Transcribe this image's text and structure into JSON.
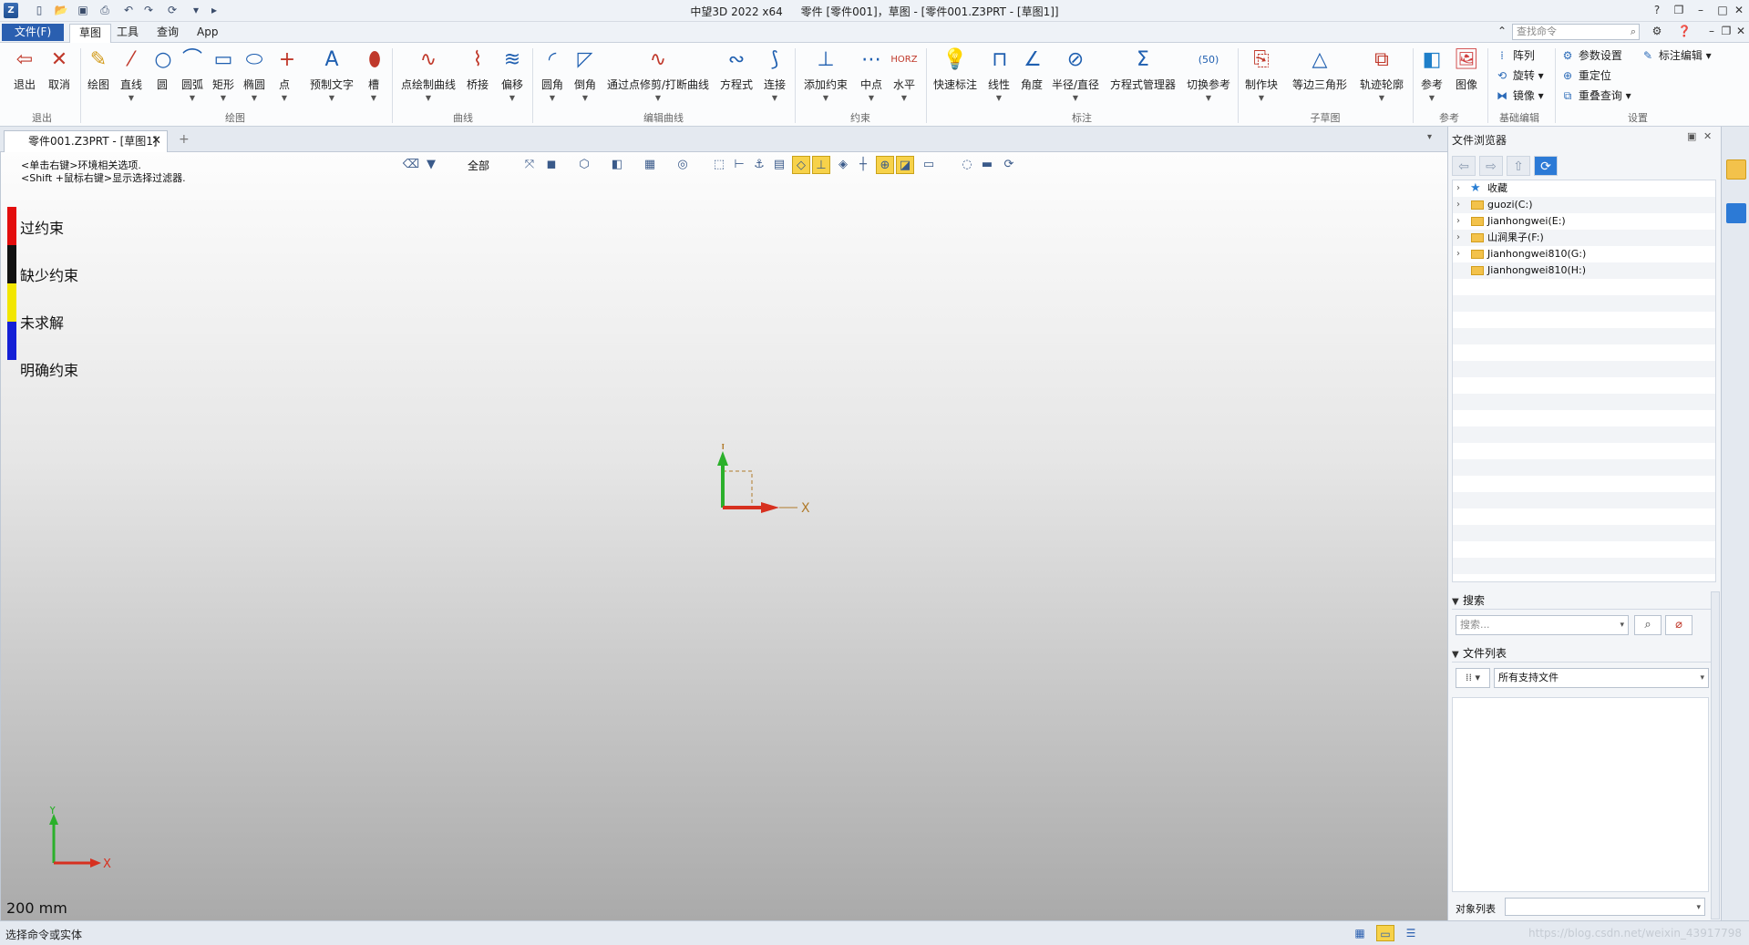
{
  "titlebar": {
    "app": "中望3D 2022 x64",
    "doc": "零件 [零件001]，草图 - [零件001.Z3PRT - [草图1]]"
  },
  "menu": {
    "file": "文件(F)",
    "tabs": [
      "草图",
      "工具",
      "查询",
      "App"
    ],
    "search_placeholder": "查找命令"
  },
  "ribbon": {
    "exit_group": {
      "label": "退出",
      "buttons": [
        "退出",
        "取消"
      ]
    },
    "draw_group": {
      "label": "绘图",
      "buttons": [
        "绘图",
        "直线",
        "圆",
        "圆弧",
        "矩形",
        "椭圆",
        "点",
        "预制文字",
        "槽"
      ]
    },
    "curve_group": {
      "label": "曲线",
      "buttons": [
        "点绘制曲线",
        "桥接",
        "偏移"
      ]
    },
    "edit_group": {
      "label": "编辑曲线",
      "buttons": [
        "圆角",
        "倒角",
        "通过点修剪/打断曲线",
        "方程式",
        "连接"
      ]
    },
    "constraint_group": {
      "label": "约束",
      "buttons": [
        "添加约束",
        "中点",
        "水平"
      ]
    },
    "dim_group": {
      "label": "标注",
      "buttons": [
        "快速标注",
        "线性",
        "角度",
        "半径/直径",
        "方程式管理器",
        "切换参考"
      ]
    },
    "subsketch_group": {
      "label": "子草图",
      "buttons": [
        "制作块",
        "等边三角形",
        "轨迹轮廓"
      ]
    },
    "ref_group": {
      "label": "参考",
      "buttons": [
        "参考",
        "图像"
      ]
    },
    "basic_edit_group": {
      "label": "基础编辑",
      "items": [
        "阵列",
        "旋转",
        "镜像"
      ]
    },
    "settings_group": {
      "label": "设置",
      "items": [
        "参数设置",
        "重定位",
        "重叠查询",
        "标注编辑"
      ]
    }
  },
  "doc_tab": {
    "label": "零件001.Z3PRT - [草图1]"
  },
  "viewport": {
    "hint1": "<单击右键>环境相关选项.",
    "hint2": "<Shift +鼠标右键>显示选择过滤器.",
    "filter_label": "全部",
    "legend": [
      {
        "label": "过约束",
        "color": "#e30d0d"
      },
      {
        "label": "缺少约束",
        "color": "#111111"
      },
      {
        "label": "未求解",
        "color": "#f2e600"
      },
      {
        "label": "明确约束",
        "color": "#1420d6"
      }
    ],
    "axis_x": "X",
    "axis_y": "Y",
    "scale": "200 mm"
  },
  "browser": {
    "title": "文件浏览器",
    "tree": [
      {
        "label": "收藏",
        "kind": "star"
      },
      {
        "label": "guozi(C:)",
        "kind": "folder"
      },
      {
        "label": "Jianhongwei(E:)",
        "kind": "folder"
      },
      {
        "label": "山涧果子(F:)",
        "kind": "folder"
      },
      {
        "label": "Jianhongwei810(G:)",
        "kind": "folder"
      },
      {
        "label": "Jianhongwei810(H:)",
        "kind": "folder"
      }
    ],
    "search_section": "搜索",
    "search_placeholder": "搜索...",
    "filelist_section": "文件列表",
    "filter_value": "所有支持文件",
    "object_list_label": "对象列表"
  },
  "status": {
    "text": "选择命令或实体",
    "watermark": "https://blog.csdn.net/weixin_43917798"
  }
}
